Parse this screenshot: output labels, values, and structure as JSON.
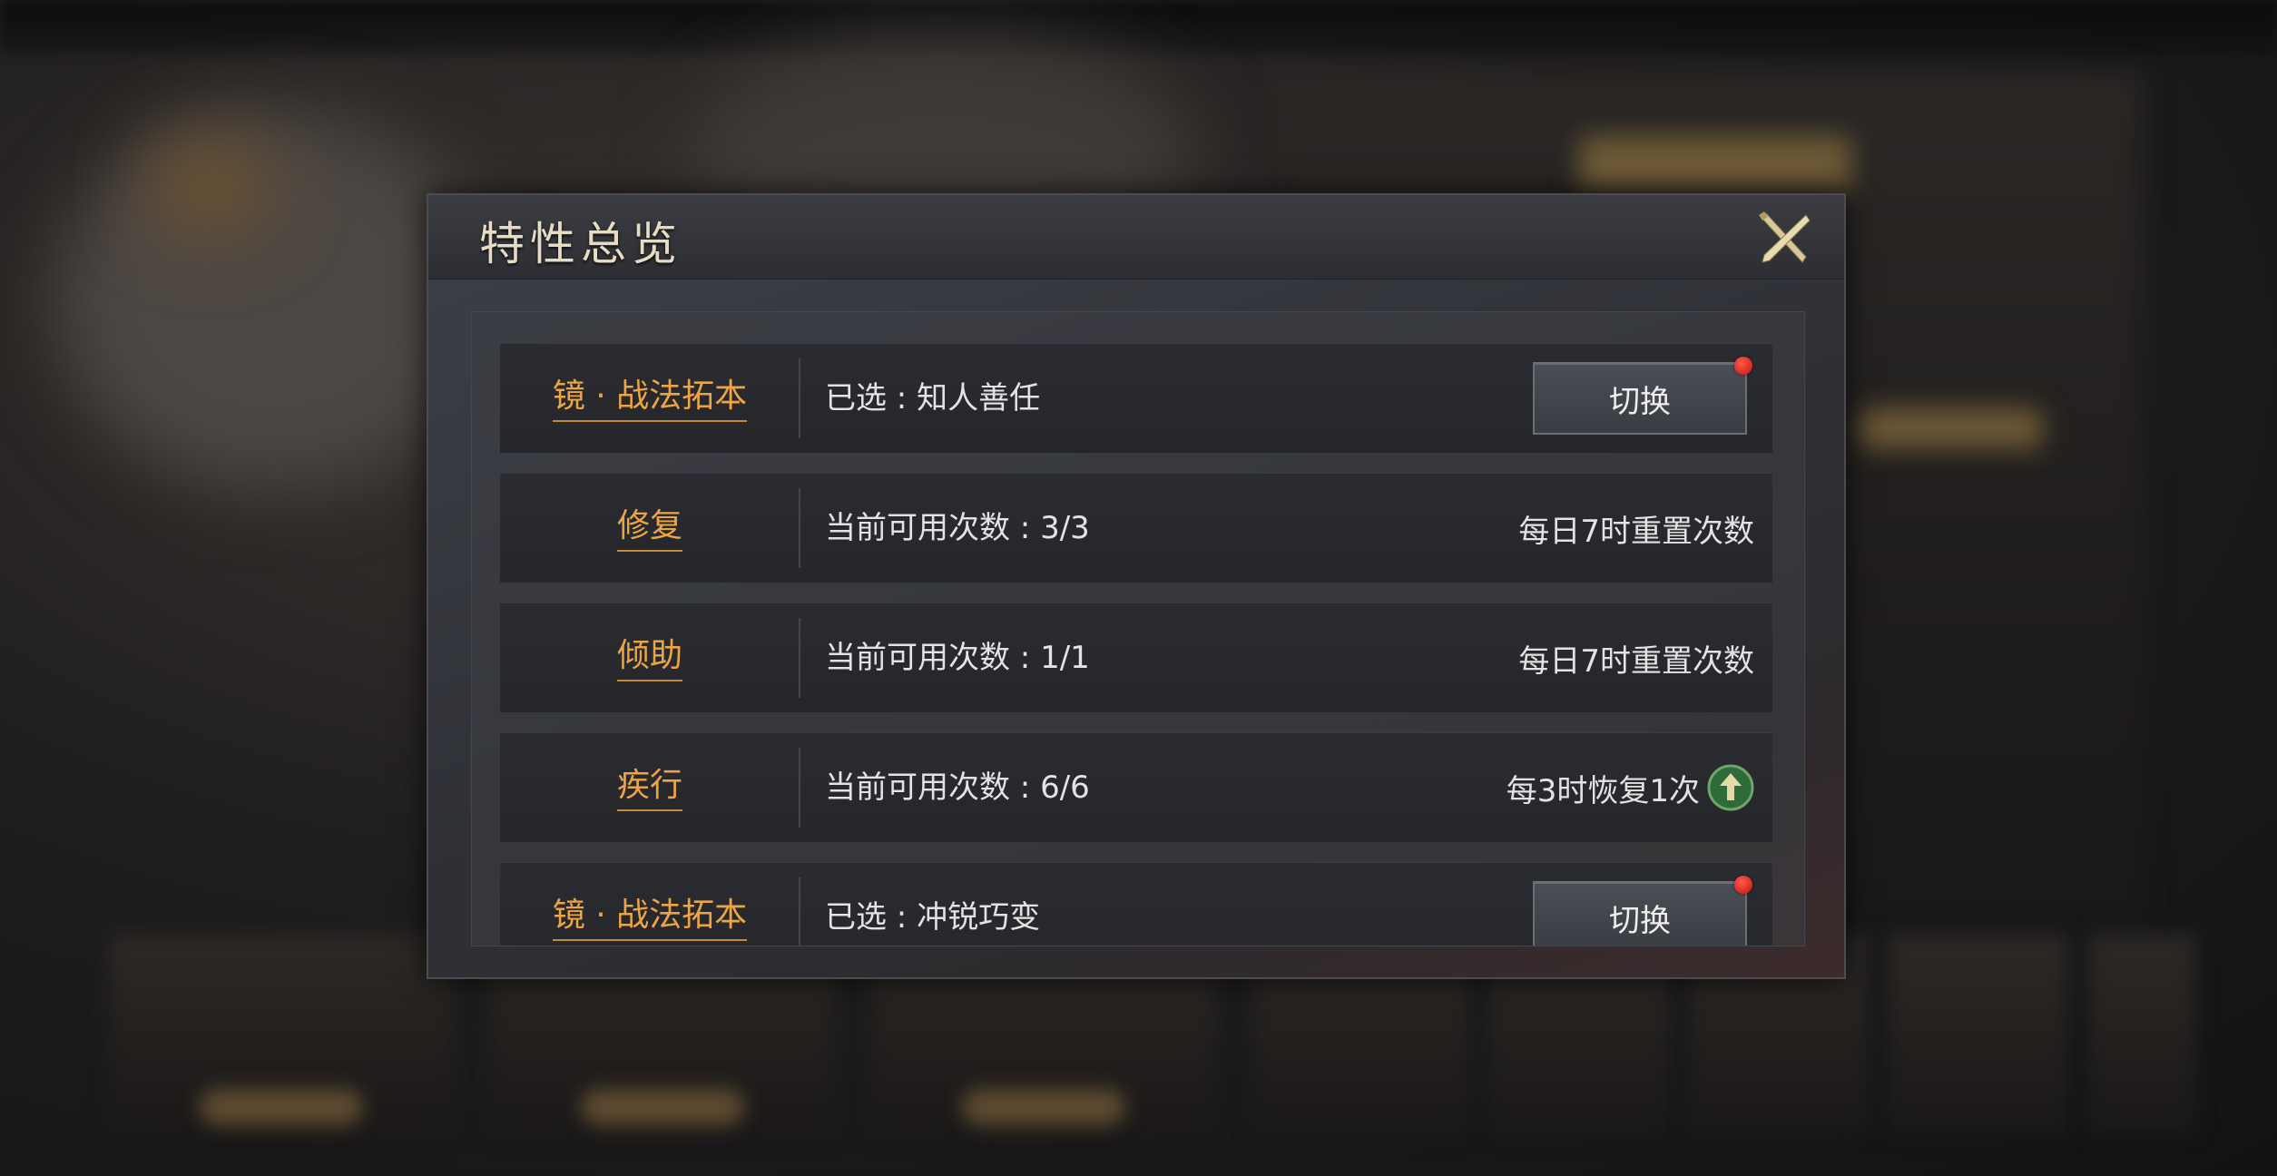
{
  "dialog": {
    "title": "特性总览",
    "close_icon": "crossed-blades-close-icon"
  },
  "rows": [
    {
      "name": "镜 · 战法拓本",
      "info": "已选 : 知人善任",
      "action": {
        "type": "button",
        "label": "切换",
        "has_red_dot": true
      }
    },
    {
      "name": "修复",
      "info": "当前可用次数 : 3/3",
      "note": "每日7时重置次数"
    },
    {
      "name": "倾助",
      "info": "当前可用次数 : 1/1",
      "note": "每日7时重置次数"
    },
    {
      "name": "疾行",
      "info": "当前可用次数 : 6/6",
      "note": "每3时恢复1次",
      "note_icon": "green-up-arrow-icon"
    },
    {
      "name": "镜 · 战法拓本",
      "info": "已选 : 冲锐巧变",
      "action": {
        "type": "button",
        "label": "切换",
        "has_red_dot": true
      }
    }
  ],
  "colors": {
    "accent_orange": "#eba547",
    "title_gold": "#e6dcc4",
    "red_dot": "#e0241c",
    "up_icon_green": "#2f6b3a"
  }
}
